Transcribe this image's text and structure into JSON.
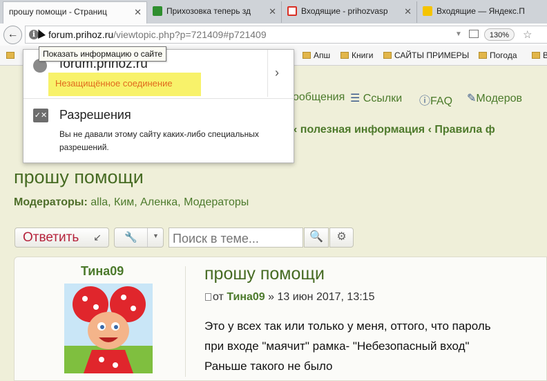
{
  "tabs": [
    {
      "title": "прошу помощи - Страниц",
      "active": true,
      "favicon_color": "#fbfbfb"
    },
    {
      "title": "Прихозовка теперь зд",
      "active": false,
      "favicon_color": "#2f8f2f"
    },
    {
      "title": "Входящие - prihozvasp",
      "active": false,
      "favicon_color": "#d93025"
    },
    {
      "title": "Входящие — Яндекс.П",
      "active": false,
      "favicon_color": "#f5c400"
    }
  ],
  "navbar": {
    "back_icon": "back-arrow-icon",
    "url_host": "forum.prihoz.ru",
    "url_path": "/viewtopic.php?p=721409#p721409",
    "zoom": "130%"
  },
  "bookmarks": [
    "Апш",
    "Книги",
    "САЙТЫ ПРИМЕРЫ",
    "Погода",
    "В"
  ],
  "tooltip": "Показать информацию о сайте",
  "site_panel": {
    "host": "forum.prihoz.ru",
    "security": "Незащищённое соединение",
    "permissions_title": "Разрешения",
    "permissions_desc": "Вы не давали этому сайту каких-либо специальных разрешений."
  },
  "forum_nav": {
    "messages": "ообщения",
    "links": "Ссылки",
    "faq": "FAQ",
    "moderation": "Модеров"
  },
  "breadcrumbs": "‹  полезная информация  ‹  Правила ф",
  "topic": {
    "title": "прошу помощи",
    "moderators_label": "Модераторы:",
    "moderators": "alla, Ким, Аленка, Модераторы"
  },
  "actions": {
    "reply": "Ответить",
    "search_placeholder": "Поиск в теме..."
  },
  "post": {
    "author": "Тина09",
    "title": "прошу помощи",
    "meta_prefix": "от",
    "meta_author": "Тина09",
    "meta_date": "» 13 июн 2017, 13:15",
    "lines": [
      "Это у всех так или только у меня, оттого, что пароль",
      "при входе \"маячит\" рамка- \"Небезопасный вход\"",
      "Раньше такого не было"
    ]
  },
  "colors": {
    "link_green": "#4c7a2c",
    "reply_red": "#b5223b",
    "warn_bg": "#f8f26a",
    "warn_text": "#e06a1d"
  }
}
